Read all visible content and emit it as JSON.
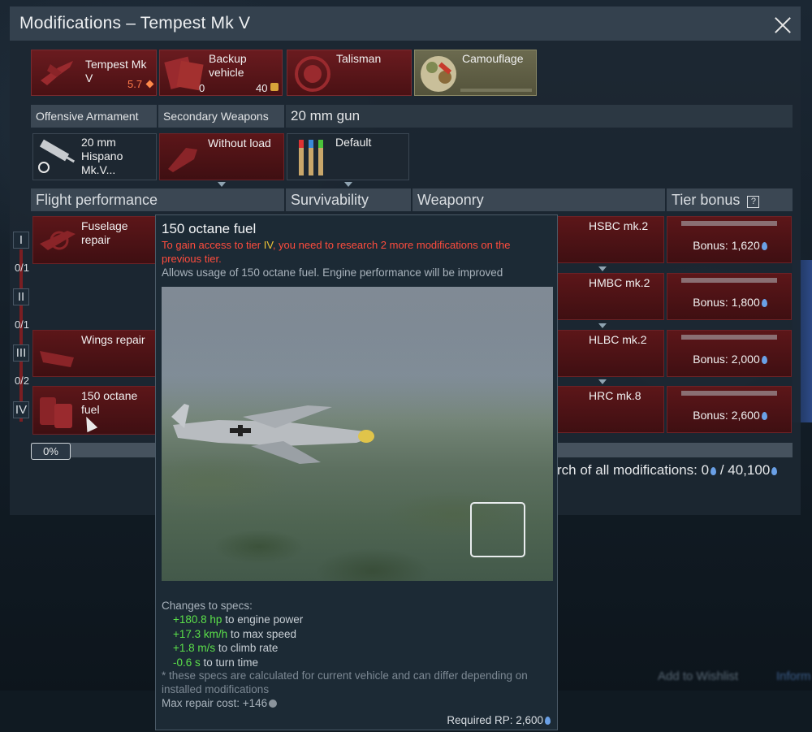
{
  "window": {
    "title": "Modifications – Tempest Mk V"
  },
  "slots": {
    "vehicle": {
      "name": "Tempest Mk V",
      "br": "5.7"
    },
    "backup": {
      "label": "Backup vehicle",
      "count": "0",
      "cost": "40"
    },
    "talisman": {
      "label": "Talisman"
    },
    "camouflage": {
      "label": "Camouflage"
    }
  },
  "weapon_tabs": {
    "offensive": "Offensive Armament",
    "secondary": "Secondary Weapons",
    "gun_title": "20 mm gun",
    "gun_item": "20 mm Hispano Mk.V...",
    "secondary_item": "Without load",
    "ammo_item": "Default"
  },
  "sections": {
    "flight": "Flight performance",
    "survivability": "Survivability",
    "weaponry": "Weaponry",
    "tier_bonus": "Tier bonus"
  },
  "tiers": {
    "numerals": [
      "I",
      "II",
      "III",
      "IV"
    ],
    "counts": [
      "0/1",
      "0/1",
      "0/2"
    ]
  },
  "flight_mods": {
    "fuselage": "Fuselage repair",
    "wings": "Wings repair",
    "fuel": "150 octane fuel"
  },
  "weaponry_mods": [
    "HSBC mk.2",
    "HMBC mk.2",
    "HLBC mk.2",
    "HRC mk.8"
  ],
  "tier_bonuses": [
    "Bonus: 1,620",
    "Bonus: 1,800",
    "Bonus: 2,000",
    "Bonus: 2,600"
  ],
  "progress": {
    "percent_label": "0%",
    "research_text": "rch of all modifications: 0",
    "total": "/ 40,100"
  },
  "tooltip": {
    "title": "150 octane fuel",
    "warn_pre": "To gain access to tier ",
    "warn_tier": "IV",
    "warn_post": ", you need to research 2 more modifications on the previous tier.",
    "desc": "Allows usage of 150 octane fuel. Engine performance will be improved",
    "changes_title": "Changes to specs:",
    "changes": [
      {
        "value": "+180.8 hp",
        "text": " to engine power"
      },
      {
        "value": "+17.3 km/h",
        "text": " to max speed"
      },
      {
        "value": "+1.8 m/s",
        "text": " to climb rate"
      },
      {
        "value": "-0.6 s",
        "text": " to turn time"
      }
    ],
    "note": "* these specs are calculated for current vehicle and can differ depending on installed modifications",
    "repair_label": "Max repair cost: +146",
    "required_label": "Required RP: 2,600"
  },
  "background_buttons": {
    "wishlist": "Add to Wishlist",
    "info": "Inform"
  },
  "colors": {
    "accent_red": "#6a1b1f",
    "warning": "#ff4c3d",
    "positive": "#5be04a",
    "rp_blue": "#6aa0e6",
    "tier_highlight": "#f0c537"
  }
}
